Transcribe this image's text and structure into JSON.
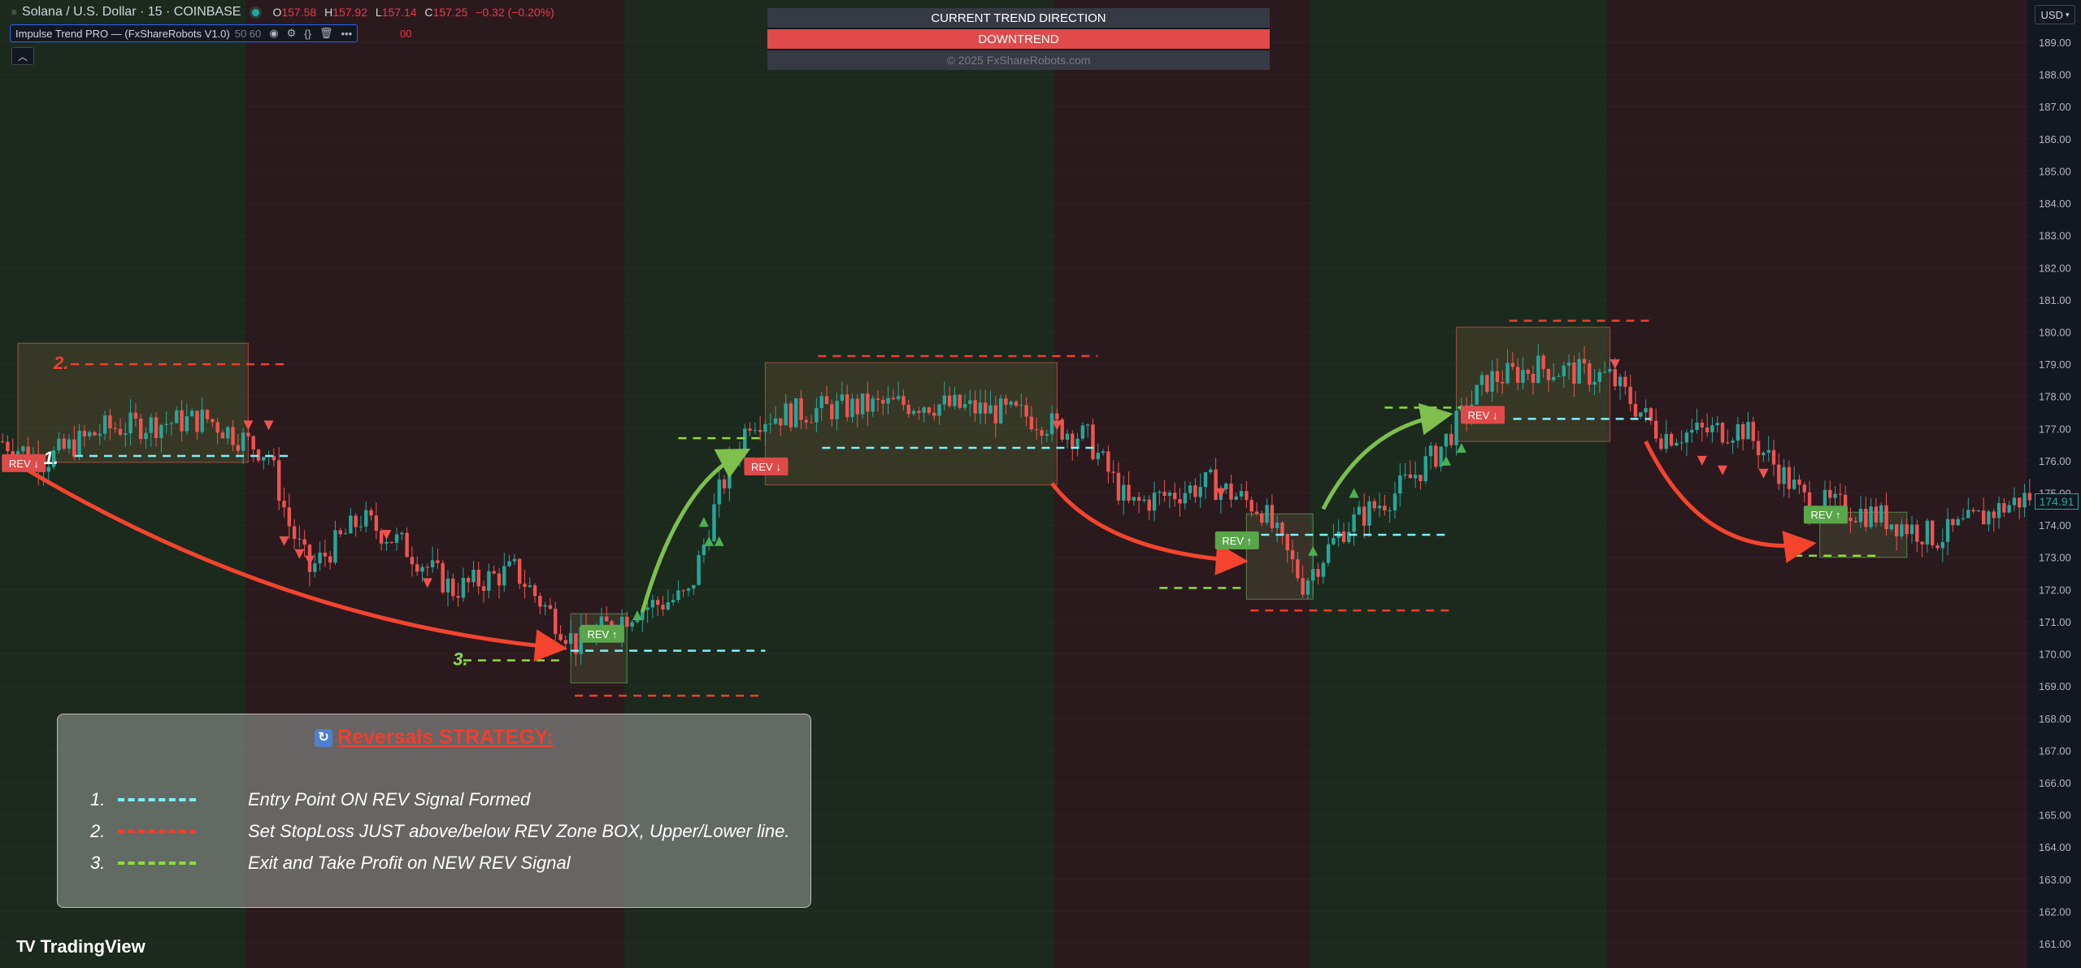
{
  "header": {
    "symbol_title": "Solana / U.S. Dollar · 15 · COINBASE",
    "ohlc": [
      {
        "k": "O",
        "v": "157.58"
      },
      {
        "k": "H",
        "v": "157.92"
      },
      {
        "k": "L",
        "v": "157.14"
      },
      {
        "k": "C",
        "v": "157.25"
      }
    ],
    "change": "−0.32 (−0.20%)"
  },
  "indicator": {
    "name": "Impulse Trend PRO — (FxShareRobots V1.0)",
    "values": "50 60",
    "extra": "00"
  },
  "trend_panel": {
    "header": "CURRENT TREND DIRECTION",
    "status": "DOWNTREND",
    "copyright": "© 2025 FxShareRobots.com"
  },
  "strategy": {
    "title": "Reversals STRATEGY:",
    "rows": [
      {
        "num": "1.",
        "text": "Entry Point ON REV Signal Formed",
        "color": "#7df0f5"
      },
      {
        "num": "2.",
        "text": "Set StopLoss JUST above/below REV Zone BOX, Upper/Lower line.",
        "color": "#f23d2f"
      },
      {
        "num": "3.",
        "text": "Exit and Take Profit on NEW REV Signal",
        "color": "#8edc3c"
      }
    ]
  },
  "chart_labels": {
    "rev_up": "REV ↑",
    "rev_down": "REV ↓",
    "step1": "1.",
    "step2": "2.",
    "step3": "3."
  },
  "price_axis": {
    "currency": "USD",
    "current_price": "174.91",
    "ticks": [
      "189.00",
      "188.00",
      "187.00",
      "186.00",
      "185.00",
      "184.00",
      "183.00",
      "182.00",
      "181.00",
      "180.00",
      "179.00",
      "178.00",
      "177.00",
      "176.00",
      "175.00",
      "174.00",
      "173.00",
      "172.00",
      "171.00",
      "170.00",
      "169.00",
      "168.00",
      "167.00",
      "166.00",
      "165.00",
      "164.00",
      "163.00",
      "162.00",
      "161.00"
    ]
  },
  "branding": {
    "logo": "TradingView"
  },
  "colors": {
    "background": "#131722",
    "up_candle": "#26a69a",
    "down_candle": "#ef5350",
    "uptrend_zone": "#1b2a1d",
    "downtrend_zone": "#2a1a1e",
    "entry_line": "#7df0f5",
    "stoploss_line": "#f23d2f",
    "takeprofit_line": "#8edc3c"
  },
  "chart_data": {
    "type": "candlestick",
    "symbol": "Solana / U.S. Dollar",
    "timeframe": "15",
    "exchange": "COINBASE",
    "ylim": [
      160.8,
      189.7
    ],
    "close_path": [
      {
        "bar": 0,
        "price": 176.6
      },
      {
        "bar": 8,
        "price": 176.0
      },
      {
        "bar": 20,
        "price": 177.0
      },
      {
        "bar": 40,
        "price": 177.3
      },
      {
        "bar": 52,
        "price": 176.2
      },
      {
        "bar": 56,
        "price": 174.0
      },
      {
        "bar": 60,
        "price": 172.6
      },
      {
        "bar": 70,
        "price": 174.2
      },
      {
        "bar": 78,
        "price": 173.4
      },
      {
        "bar": 88,
        "price": 172.0
      },
      {
        "bar": 100,
        "price": 172.6
      },
      {
        "bar": 112,
        "price": 170.3
      },
      {
        "bar": 124,
        "price": 171.4
      },
      {
        "bar": 134,
        "price": 171.8
      },
      {
        "bar": 140,
        "price": 175.0
      },
      {
        "bar": 146,
        "price": 177.3
      },
      {
        "bar": 160,
        "price": 177.6
      },
      {
        "bar": 180,
        "price": 177.8
      },
      {
        "bar": 200,
        "price": 177.4
      },
      {
        "bar": 212,
        "price": 176.7
      },
      {
        "bar": 220,
        "price": 174.6
      },
      {
        "bar": 236,
        "price": 175.3
      },
      {
        "bar": 246,
        "price": 174.5
      },
      {
        "bar": 254,
        "price": 172.2
      },
      {
        "bar": 262,
        "price": 173.9
      },
      {
        "bar": 272,
        "price": 175.0
      },
      {
        "bar": 280,
        "price": 176.2
      },
      {
        "bar": 290,
        "price": 178.5
      },
      {
        "bar": 300,
        "price": 178.9
      },
      {
        "bar": 314,
        "price": 178.6
      },
      {
        "bar": 324,
        "price": 176.8
      },
      {
        "bar": 340,
        "price": 177.0
      },
      {
        "bar": 352,
        "price": 174.8
      },
      {
        "bar": 366,
        "price": 174.3
      },
      {
        "bar": 378,
        "price": 173.6
      },
      {
        "bar": 390,
        "price": 174.5
      },
      {
        "bar": 396,
        "price": 174.9
      }
    ],
    "trend_zones": [
      {
        "from_bar": 0,
        "to_bar": 48,
        "trend": "up"
      },
      {
        "from_bar": 48,
        "to_bar": 122,
        "trend": "down"
      },
      {
        "from_bar": 122,
        "to_bar": 206,
        "trend": "up"
      },
      {
        "from_bar": 206,
        "to_bar": 256,
        "trend": "down"
      },
      {
        "from_bar": 256,
        "to_bar": 314,
        "trend": "up"
      },
      {
        "from_bar": 314,
        "to_bar": 396,
        "trend": "down"
      }
    ],
    "rev_zones": [
      {
        "from_bar": 3,
        "to_bar": 48,
        "low": 175.95,
        "high": 179.65,
        "direction": "down",
        "entry": 176.15,
        "stop": 179.0
      },
      {
        "from_bar": 111,
        "to_bar": 122,
        "low": 169.1,
        "high": 171.25,
        "direction": "up",
        "entry": 170.1,
        "stop": 168.7
      },
      {
        "from_bar": 149,
        "to_bar": 206,
        "low": 175.25,
        "high": 179.05,
        "direction": "down",
        "entry": 176.4,
        "stop": 179.25
      },
      {
        "from_bar": 243,
        "to_bar": 256,
        "low": 171.7,
        "high": 174.35,
        "direction": "up",
        "entry": 173.7,
        "stop": 171.35
      },
      {
        "from_bar": 284,
        "to_bar": 314,
        "low": 176.6,
        "high": 180.15,
        "direction": "down",
        "entry": 177.3,
        "stop": 180.35
      },
      {
        "from_bar": 355,
        "to_bar": 372,
        "low": 173.0,
        "high": 174.4,
        "direction": "up",
        "entry": null,
        "stop": null
      }
    ],
    "take_profit_levels": [
      {
        "from_bar": 90,
        "to_bar": 109,
        "price": 169.8
      },
      {
        "from_bar": 132,
        "to_bar": 148,
        "price": 176.7
      },
      {
        "from_bar": 226,
        "to_bar": 243,
        "price": 172.05
      },
      {
        "from_bar": 270,
        "to_bar": 285,
        "price": 177.65
      },
      {
        "from_bar": 350,
        "to_bar": 366,
        "price": 173.05
      }
    ],
    "signal_arrows": {
      "down": [
        {
          "bar": 48,
          "price": 177.1
        },
        {
          "bar": 52,
          "price": 177.1
        },
        {
          "bar": 55,
          "price": 173.5
        },
        {
          "bar": 58,
          "price": 173.1
        },
        {
          "bar": 60,
          "price": 172.9
        },
        {
          "bar": 75,
          "price": 173.7
        },
        {
          "bar": 83,
          "price": 172.2
        },
        {
          "bar": 206,
          "price": 177.1
        },
        {
          "bar": 238,
          "price": 175.0
        },
        {
          "bar": 315,
          "price": 179.0
        },
        {
          "bar": 332,
          "price": 176.0
        },
        {
          "bar": 336,
          "price": 175.7
        },
        {
          "bar": 344,
          "price": 175.6
        }
      ],
      "up": [
        {
          "bar": 137,
          "price": 174.1
        },
        {
          "bar": 138,
          "price": 173.5
        },
        {
          "bar": 140,
          "price": 173.5
        },
        {
          "bar": 124,
          "price": 171.2
        },
        {
          "bar": 256,
          "price": 173.2
        },
        {
          "bar": 264,
          "price": 175.0
        },
        {
          "bar": 282,
          "price": 176.0
        },
        {
          "bar": 285,
          "price": 176.4
        }
      ]
    }
  }
}
